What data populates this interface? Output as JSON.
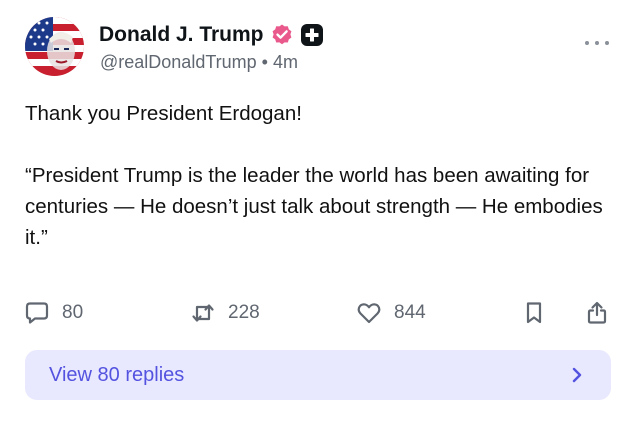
{
  "author": {
    "display_name": "Donald J. Trump",
    "handle": "@realDonaldTrump",
    "separator": "•",
    "timestamp": "4m",
    "verified": true,
    "verified_color": "#e9598c"
  },
  "post": {
    "paragraphs": [
      "Thank you President Erdogan!",
      "“President Trump is the leader the world has been awaiting for centuries — He doesn’t just talk about strength — He embodies it.”"
    ]
  },
  "actions": {
    "reply_count": "80",
    "repost_count": "228",
    "like_count": "844",
    "icons": [
      "reply-icon",
      "repost-icon",
      "like-icon",
      "bookmark-icon",
      "share-icon"
    ]
  },
  "replies_button": {
    "label": "View 80 replies",
    "background": "#e8e8ff",
    "text_color": "#5453e0"
  }
}
